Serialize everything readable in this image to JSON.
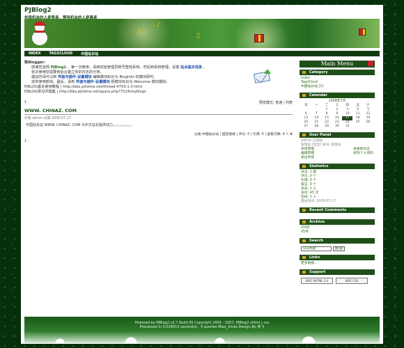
{
  "site": {
    "title": "PJBlog2",
    "subtitle": "创造机会的人是勇者，等待机会的人是愚者"
  },
  "nav": {
    "items": [
      "INDEX",
      "TAGSCLOUD",
      "中国站长站"
    ]
  },
  "welcome": {
    "greeting": "致Blogger:",
    "line1_pre": "感谢您选择",
    "line1_brand": "PJBlog2",
    "line1_mid": "，第一次使用，请用初始管理员账号登陆系统，然后到系统管理，设置",
    "line1_link": "站点基本信息",
    "line1_end": "。",
    "line2": "初次使用您需要到后台建立你的日志的分类。",
    "line3_pre": "建站时请可以到",
    "line3_link": "界面与插件-设置模块",
    "line3_end": "编辑模块标识为 BlogInfo 的模块即可。",
    "line4_pre": "找你使用愉快。最后，请到",
    "line4_link": "界面与插件-设置模块",
    "line4_end": "把模块标识为 Welcome 模块删除。",
    "line5": "PJBLOG基本使用教程 | http://bbs.pjhome.net/thread-4753-1-3.html",
    "line6": "PJBLOG常见问题集 | http://bbs.pjhome.net/space.php?7524/myblogs"
  },
  "viewbar": {
    "page": "1",
    "mode_label": "预览模式:",
    "mode_normal": "普通",
    "mode_list": "列表"
  },
  "post": {
    "title": "WWW. CHINAZ. COM",
    "meta": "作者:admin 日期:2008-07-17",
    "body": "中国站长站 WWW. CHINAZ. COM 为中文站长提供动力。。。。。。。。。。。",
    "footer": "分类:中国站长站 | 固定链接 | 评论: 0 | 引用: 0 | 查看次数: 4",
    "page": "1"
  },
  "sidebar": {
    "menu_title": "Main Menu",
    "category": {
      "title": "Category",
      "items": [
        "Index",
        "TagsCloud",
        "中国站长站 [1]"
      ]
    },
    "calendar": {
      "title": "Calendar",
      "caption": "2008年7月",
      "weekdays": [
        "日",
        "一",
        "二",
        "三",
        "四",
        "五",
        "六"
      ],
      "rows": [
        [
          "",
          "",
          "1",
          "2",
          "3",
          "4",
          "5"
        ],
        [
          "6",
          "7",
          "8",
          "9",
          "10",
          "11",
          "12"
        ],
        [
          "13",
          "14",
          "15",
          "16",
          "17",
          "18",
          "19"
        ],
        [
          "20",
          "21",
          "22",
          "23",
          "24",
          "25",
          "26"
        ],
        [
          "27",
          "28",
          "29",
          "30",
          "31",
          "",
          ""
        ]
      ],
      "today": "17"
    },
    "user_panel": {
      "title": "User Panel",
      "greeting": "admin 已登陆",
      "role": "管理员 [登出] 身份: 管理员",
      "links_left": [
        "系统管理",
        "编辑草稿",
        "退出系统"
      ],
      "links_right": [
        "发表新日志",
        "修改个人资料"
      ]
    },
    "statistics": {
      "title": "Statistics",
      "lines": [
        "日志: 1 篇",
        "评论: 0 个",
        "引用: 0 个",
        "留言: 0 个",
        "会员: 1 人",
        "访问: 43 次",
        "在线: 1 人",
        "建站时间: 2008-07-17"
      ]
    },
    "recent_comments": {
      "title": "Recent Comments"
    },
    "archive": {
      "title": "Archive",
      "items": [
        "2008",
        "05月"
      ]
    },
    "search": {
      "title": "Search",
      "select_value": "日志标题",
      "button_label": "搜 索"
    },
    "links": {
      "title": "Links",
      "items": [
        "更多链接..."
      ]
    },
    "support": {
      "title": "Support",
      "badges": [
        "W3C XHTML 1.0",
        "W3C CSS"
      ]
    }
  },
  "footer": {
    "line1": "Powered by PJBlog2 v2.7 Build 05 Copyright 2005 - 2007, PJBlog2 xhtml | css",
    "line2": "Processed in 0.016013 second(s) , 5 queries    Mias_Xmas Design By 夜飞"
  }
}
